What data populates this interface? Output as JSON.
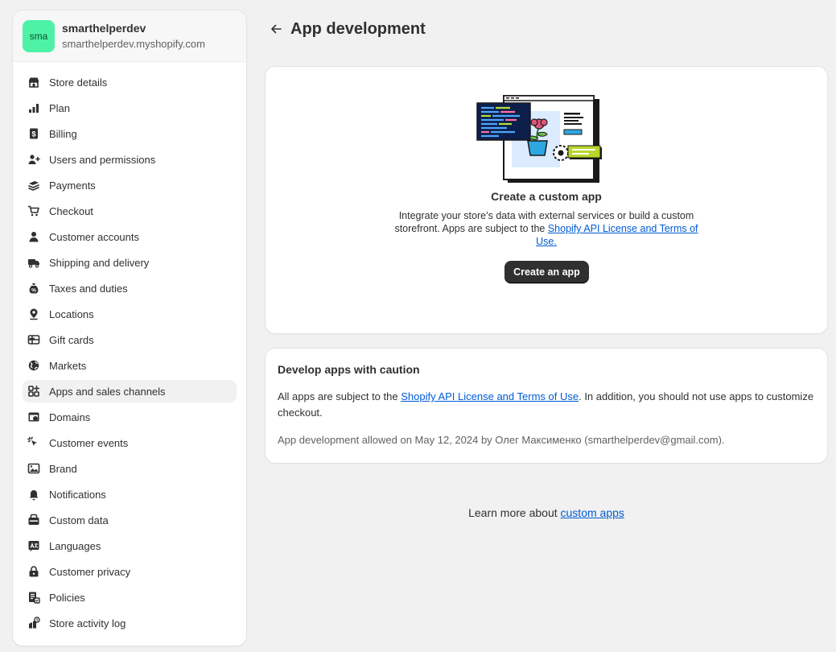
{
  "store": {
    "avatar_text": "sma",
    "name": "smarthelperdev",
    "domain": "smarthelperdev.myshopify.com"
  },
  "sidebar": {
    "items": [
      {
        "label": "Store details",
        "icon": "store-icon"
      },
      {
        "label": "Plan",
        "icon": "plan-icon"
      },
      {
        "label": "Billing",
        "icon": "billing-icon"
      },
      {
        "label": "Users and permissions",
        "icon": "users-icon"
      },
      {
        "label": "Payments",
        "icon": "payments-icon"
      },
      {
        "label": "Checkout",
        "icon": "cart-icon"
      },
      {
        "label": "Customer accounts",
        "icon": "person-icon"
      },
      {
        "label": "Shipping and delivery",
        "icon": "truck-icon"
      },
      {
        "label": "Taxes and duties",
        "icon": "tax-icon"
      },
      {
        "label": "Locations",
        "icon": "location-icon"
      },
      {
        "label": "Gift cards",
        "icon": "gift-card-icon"
      },
      {
        "label": "Markets",
        "icon": "globe-icon"
      },
      {
        "label": "Apps and sales channels",
        "icon": "apps-icon",
        "active": true
      },
      {
        "label": "Domains",
        "icon": "domain-icon"
      },
      {
        "label": "Customer events",
        "icon": "cursor-icon"
      },
      {
        "label": "Brand",
        "icon": "brand-icon"
      },
      {
        "label": "Notifications",
        "icon": "bell-icon"
      },
      {
        "label": "Custom data",
        "icon": "database-icon"
      },
      {
        "label": "Languages",
        "icon": "language-icon"
      },
      {
        "label": "Customer privacy",
        "icon": "lock-icon"
      },
      {
        "label": "Policies",
        "icon": "policy-icon"
      },
      {
        "label": "Store activity log",
        "icon": "activity-log-icon"
      }
    ]
  },
  "page": {
    "title": "App development"
  },
  "hero": {
    "title": "Create a custom app",
    "desc_before": "Integrate your store’s data with external services or build a custom storefront. Apps are subject to the ",
    "link": "Shopify API License and Terms of Use.",
    "button": "Create an app"
  },
  "caution": {
    "title": "Develop apps with caution",
    "text_before": "All apps are subject to the ",
    "link": "Shopify API License and Terms of Use",
    "text_after": ". In addition, you should not use apps to customize checkout.",
    "meta": "App development allowed on May 12, 2024 by Олег Максименко (smarthelperdev@gmail.com)."
  },
  "footer": {
    "text": "Learn more about ",
    "link": "custom apps"
  }
}
